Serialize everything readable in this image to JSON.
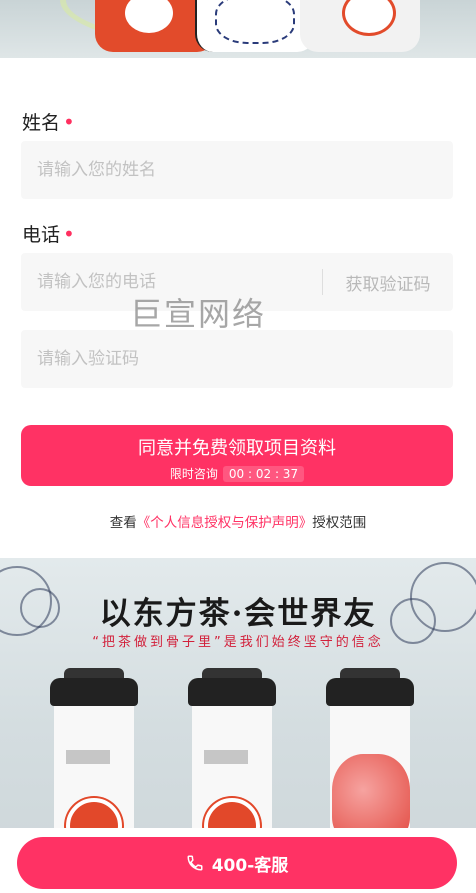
{
  "form": {
    "name_label": "姓名",
    "name_required_mark": "•",
    "name_placeholder": "请输入您的姓名",
    "phone_label": "电话",
    "phone_required_mark": "•",
    "phone_placeholder": "请输入您的电话",
    "get_code_label": "获取验证码",
    "code_placeholder": "请输入验证码"
  },
  "watermark": "巨宣网络",
  "submit": {
    "label": "同意并免费领取项目资料",
    "countdown_label": "限时咨询",
    "countdown_value": "00 : 02 : 37"
  },
  "agreement": {
    "prefix": "查看",
    "link": "《个人信息授权与保护声明》",
    "suffix": "授权范围"
  },
  "promo": {
    "title": "以东方茶·会世界友",
    "slogan": "“把茶做到骨子里”是我们始终坚守的信念"
  },
  "bottom_bar": {
    "service_label": "400-客服",
    "icon": "phone-icon"
  },
  "colors": {
    "accent": "#ff3264",
    "required": "#ff2f5f",
    "input_bg": "#f7f7f7"
  }
}
